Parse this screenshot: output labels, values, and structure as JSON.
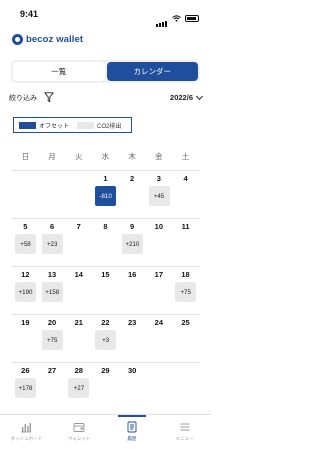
{
  "status": {
    "time": "9:41"
  },
  "app": {
    "logo_text": "becoz wallet"
  },
  "segment": {
    "list_label": "一覧",
    "calendar_label": "カレンダー",
    "active": "calendar"
  },
  "filter": {
    "label": "絞り込み",
    "month": "2022/6"
  },
  "legend": {
    "offset_label": "オフセット",
    "co2_label": "CO2排出"
  },
  "colors": {
    "accent": "#1f4e9c",
    "co2_cell": "#e8e8e8"
  },
  "weekdays": [
    "日",
    "月",
    "火",
    "水",
    "木",
    "金",
    "土"
  ],
  "calendar_weeks": [
    [
      {
        "day": "",
        "value": "",
        "type": ""
      },
      {
        "day": "",
        "value": "",
        "type": ""
      },
      {
        "day": "",
        "value": "",
        "type": ""
      },
      {
        "day": "1",
        "value": "-810",
        "type": "offset"
      },
      {
        "day": "2",
        "value": "",
        "type": ""
      },
      {
        "day": "3",
        "value": "+45",
        "type": "co2"
      },
      {
        "day": "4",
        "value": "",
        "type": ""
      }
    ],
    [
      {
        "day": "5",
        "value": "+58",
        "type": "co2"
      },
      {
        "day": "6",
        "value": "+23",
        "type": "co2"
      },
      {
        "day": "7",
        "value": "",
        "type": ""
      },
      {
        "day": "8",
        "value": "",
        "type": ""
      },
      {
        "day": "9",
        "value": "+210",
        "type": "co2"
      },
      {
        "day": "10",
        "value": "",
        "type": ""
      },
      {
        "day": "11",
        "value": "",
        "type": ""
      }
    ],
    [
      {
        "day": "12",
        "value": "+190",
        "type": "co2"
      },
      {
        "day": "13",
        "value": "+158",
        "type": "co2"
      },
      {
        "day": "14",
        "value": "",
        "type": ""
      },
      {
        "day": "15",
        "value": "",
        "type": ""
      },
      {
        "day": "16",
        "value": "",
        "type": ""
      },
      {
        "day": "17",
        "value": "",
        "type": ""
      },
      {
        "day": "18",
        "value": "+75",
        "type": "co2"
      }
    ],
    [
      {
        "day": "19",
        "value": "",
        "type": ""
      },
      {
        "day": "20",
        "value": "+75",
        "type": "co2"
      },
      {
        "day": "21",
        "value": "",
        "type": ""
      },
      {
        "day": "22",
        "value": "+3",
        "type": "co2"
      },
      {
        "day": "23",
        "value": "",
        "type": ""
      },
      {
        "day": "24",
        "value": "",
        "type": ""
      },
      {
        "day": "25",
        "value": "",
        "type": ""
      }
    ],
    [
      {
        "day": "26",
        "value": "+178",
        "type": "co2"
      },
      {
        "day": "27",
        "value": "",
        "type": ""
      },
      {
        "day": "28",
        "value": "+27",
        "type": "co2"
      },
      {
        "day": "29",
        "value": "",
        "type": ""
      },
      {
        "day": "30",
        "value": "",
        "type": ""
      },
      {
        "day": "",
        "value": "",
        "type": ""
      },
      {
        "day": "",
        "value": "",
        "type": ""
      }
    ]
  ],
  "nav": [
    {
      "label": "ダッシュボード",
      "icon": "chart-icon",
      "active": false
    },
    {
      "label": "ウォレット",
      "icon": "wallet-icon",
      "active": false
    },
    {
      "label": "履歴",
      "icon": "history-icon",
      "active": true
    },
    {
      "label": "メニュー",
      "icon": "menu-icon",
      "active": false
    }
  ]
}
